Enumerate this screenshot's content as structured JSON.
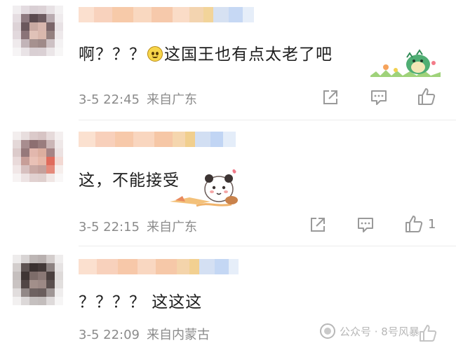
{
  "comments": [
    {
      "text_before": "啊？？？",
      "text_after": "这国王也有点太老了吧",
      "emoji": "laughing-face-emoji",
      "sticker": "green-dinosaur-sticker",
      "time": "3-5 22:45",
      "location": "来自广东",
      "likes": ""
    },
    {
      "text": "这，不能接受",
      "sticker": "panda-sticker",
      "time": "3-5 22:15",
      "location": "来自广东",
      "likes": "1"
    },
    {
      "text": "？？？？ 这这这",
      "time": "3-5 22:09",
      "location": "来自内蒙古",
      "likes": ""
    }
  ],
  "icons": {
    "share": "share-icon",
    "comment": "comment-icon",
    "like": "thumbs-up-icon"
  },
  "watermark": {
    "text": "公众号 · 8号风暴"
  },
  "colors": {
    "text": "#1d1d1d",
    "meta": "#8b8b8b",
    "icon": "#9a9a9a"
  }
}
